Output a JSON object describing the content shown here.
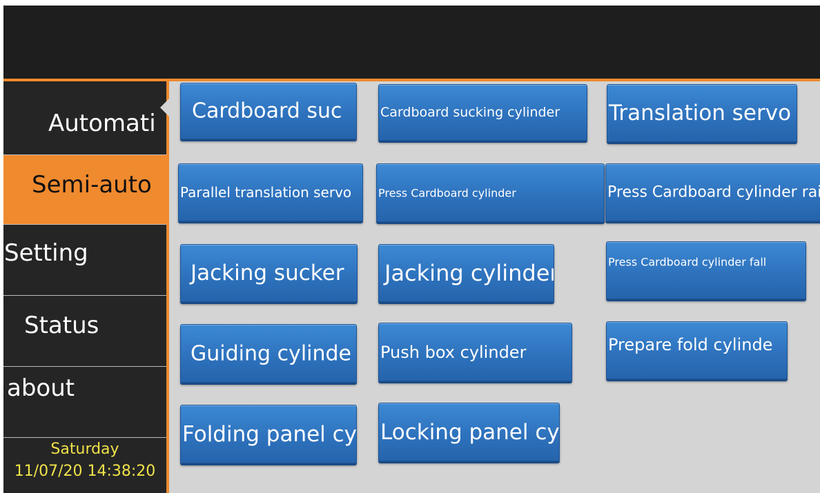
{
  "nav": {
    "items": [
      {
        "label": "Automati"
      },
      {
        "label": "Semi-auto",
        "active": true
      },
      {
        "label": "Setting"
      },
      {
        "label": "Status"
      },
      {
        "label": "about"
      }
    ],
    "datetime": {
      "day": "Saturday",
      "stamp": "11/07/20 14:38:20"
    }
  },
  "buttons": [
    {
      "label": "Cardboard suc"
    },
    {
      "label": "Cardboard sucking cylinder"
    },
    {
      "label": "Translation servo"
    },
    {
      "label": "Parallel translation servo"
    },
    {
      "label": "Press Cardboard cylinder"
    },
    {
      "label": "Press Cardboard cylinder rai"
    },
    {
      "label": "Jacking sucker"
    },
    {
      "label": "Jacking cylinder"
    },
    {
      "label": "Press Cardboard cylinder fall"
    },
    {
      "label": "Guiding cylinde"
    },
    {
      "label": "Push box cylinder"
    },
    {
      "label": "Prepare fold cylinde"
    },
    {
      "label": "Folding panel cy"
    },
    {
      "label": "Locking panel cy"
    }
  ],
  "colors": {
    "accent": "#f08a2e",
    "button": "#2e72bd",
    "clock": "#f0e24a"
  }
}
